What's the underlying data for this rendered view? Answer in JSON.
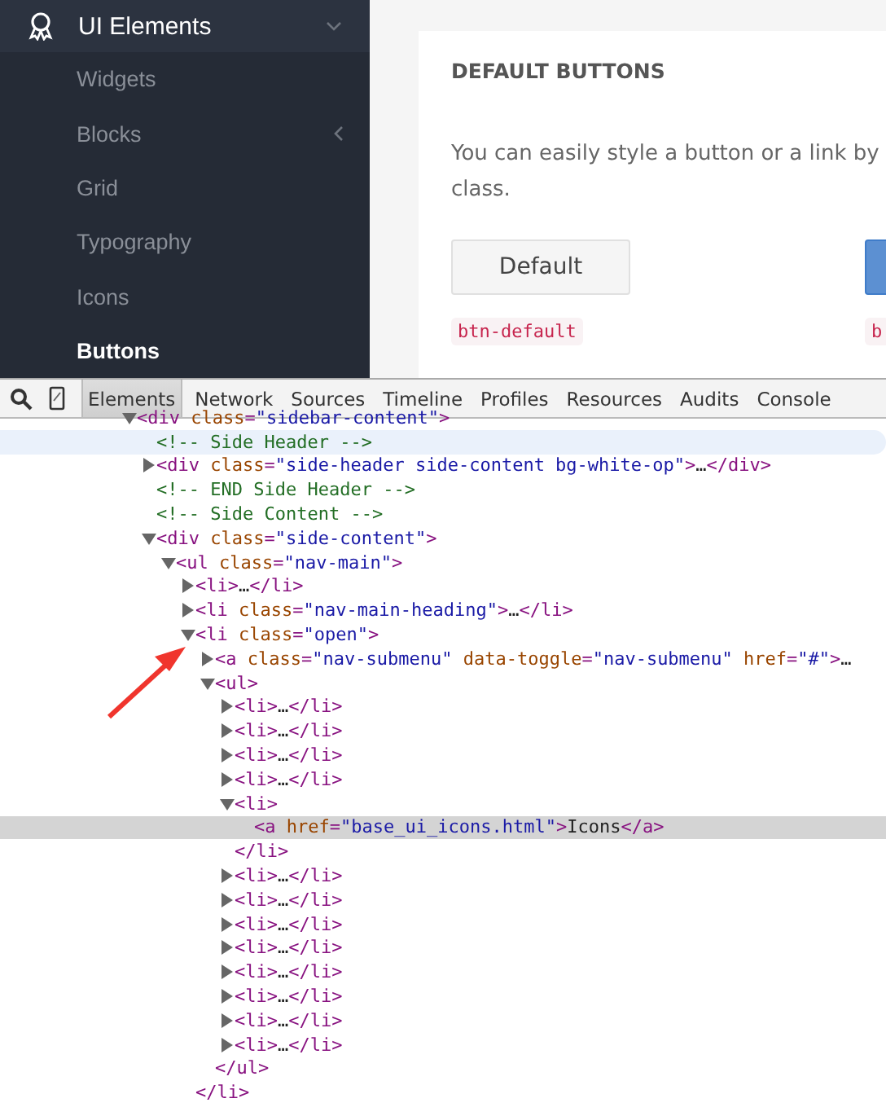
{
  "sidebar": {
    "header": {
      "label": "UI Elements",
      "expanded": true
    },
    "items": [
      {
        "label": "Widgets",
        "kind": "link",
        "selected": false
      },
      {
        "label": "Blocks",
        "kind": "submenu",
        "selected": false
      },
      {
        "label": "Grid",
        "kind": "link",
        "selected": false
      },
      {
        "label": "Typography",
        "kind": "link",
        "selected": false
      },
      {
        "label": "Icons",
        "kind": "link",
        "selected": false
      },
      {
        "label": "Buttons",
        "kind": "link",
        "selected": true
      }
    ]
  },
  "card": {
    "title": "DEFAULT BUTTONS",
    "lines": [
      "You can easily style a button or a link by",
      "class."
    ],
    "buttons": [
      {
        "label": "Default",
        "kind": "default",
        "code": "btn-default"
      },
      {
        "kind": "primary",
        "code": "b"
      }
    ]
  },
  "devtools": {
    "tabs": [
      {
        "label": "Elements",
        "selected": true
      },
      {
        "label": "Network",
        "selected": false
      },
      {
        "label": "Sources",
        "selected": false
      },
      {
        "label": "Timeline",
        "selected": false
      },
      {
        "label": "Profiles",
        "selected": false
      },
      {
        "label": "Resources",
        "selected": false
      },
      {
        "label": "Audits",
        "selected": false
      },
      {
        "label": "Console",
        "selected": false
      }
    ],
    "tree": [
      {
        "kind": "element",
        "text": "<div class=\"sidebar-content\">",
        "expanded": true,
        "selected": false,
        "hovered": false,
        "children": [
          {
            "kind": "comment",
            "text": "<!-- Side Header -->",
            "selected": false,
            "hovered": true
          },
          {
            "kind": "element",
            "text": "<div class=\"side-header side-content bg-white-op\">…</div>",
            "expanded": false,
            "selected": false,
            "hovered": false
          },
          {
            "kind": "comment",
            "text": "<!-- END Side Header -->",
            "selected": false,
            "hovered": false
          },
          {
            "kind": "comment",
            "text": "<!-- Side Content -->",
            "selected": false,
            "hovered": false
          },
          {
            "kind": "element",
            "text": "<div class=\"side-content\">",
            "expanded": true,
            "selected": false,
            "hovered": false,
            "children": [
              {
                "kind": "element",
                "text": "<ul class=\"nav-main\">",
                "expanded": true,
                "selected": false,
                "hovered": false,
                "children": [
                  {
                    "kind": "element",
                    "text": "<li>…</li>",
                    "expanded": false,
                    "selected": false,
                    "hovered": false
                  },
                  {
                    "kind": "element",
                    "text": "<li class=\"nav-main-heading\">…</li>",
                    "expanded": false,
                    "selected": false,
                    "hovered": false
                  },
                  {
                    "kind": "element",
                    "text": "<li class=\"open\">",
                    "expanded": true,
                    "selected": false,
                    "hovered": false,
                    "closing": "</li>",
                    "children": [
                      {
                        "kind": "element",
                        "text": "<a class=\"nav-submenu\" data-toggle=\"nav-submenu\" href=\"#\">…",
                        "expanded": false,
                        "selected": false,
                        "hovered": false
                      },
                      {
                        "kind": "element",
                        "text": "<ul>",
                        "expanded": true,
                        "selected": false,
                        "hovered": false,
                        "closing": "</ul>",
                        "children": [
                          {
                            "kind": "element",
                            "text": "<li>…</li>",
                            "expanded": false,
                            "selected": false,
                            "hovered": false
                          },
                          {
                            "kind": "element",
                            "text": "<li>…</li>",
                            "expanded": false,
                            "selected": false,
                            "hovered": false
                          },
                          {
                            "kind": "element",
                            "text": "<li>…</li>",
                            "expanded": false,
                            "selected": false,
                            "hovered": false
                          },
                          {
                            "kind": "element",
                            "text": "<li>…</li>",
                            "expanded": false,
                            "selected": false,
                            "hovered": false
                          },
                          {
                            "kind": "element",
                            "text": "<li>",
                            "expanded": true,
                            "selected": false,
                            "hovered": false,
                            "closing": "</li>",
                            "children": [
                              {
                                "kind": "element",
                                "text": "<a href=\"base_ui_icons.html\">Icons</a>",
                                "selected": true,
                                "hovered": false
                              }
                            ]
                          },
                          {
                            "kind": "element",
                            "text": "<li>…</li>",
                            "expanded": false,
                            "selected": false,
                            "hovered": false
                          },
                          {
                            "kind": "element",
                            "text": "<li>…</li>",
                            "expanded": false,
                            "selected": false,
                            "hovered": false
                          },
                          {
                            "kind": "element",
                            "text": "<li>…</li>",
                            "expanded": false,
                            "selected": false,
                            "hovered": false
                          },
                          {
                            "kind": "element",
                            "text": "<li>…</li>",
                            "expanded": false,
                            "selected": false,
                            "hovered": false
                          },
                          {
                            "kind": "element",
                            "text": "<li>…</li>",
                            "expanded": false,
                            "selected": false,
                            "hovered": false
                          },
                          {
                            "kind": "element",
                            "text": "<li>…</li>",
                            "expanded": false,
                            "selected": false,
                            "hovered": false
                          },
                          {
                            "kind": "element",
                            "text": "<li>…</li>",
                            "expanded": false,
                            "selected": false,
                            "hovered": false
                          },
                          {
                            "kind": "element",
                            "text": "<li>…</li>",
                            "expanded": false,
                            "selected": false,
                            "hovered": false
                          }
                        ]
                      }
                    ]
                  }
                ]
              }
            ]
          }
        ]
      }
    ]
  },
  "annotation": {
    "kind": "arrow"
  }
}
